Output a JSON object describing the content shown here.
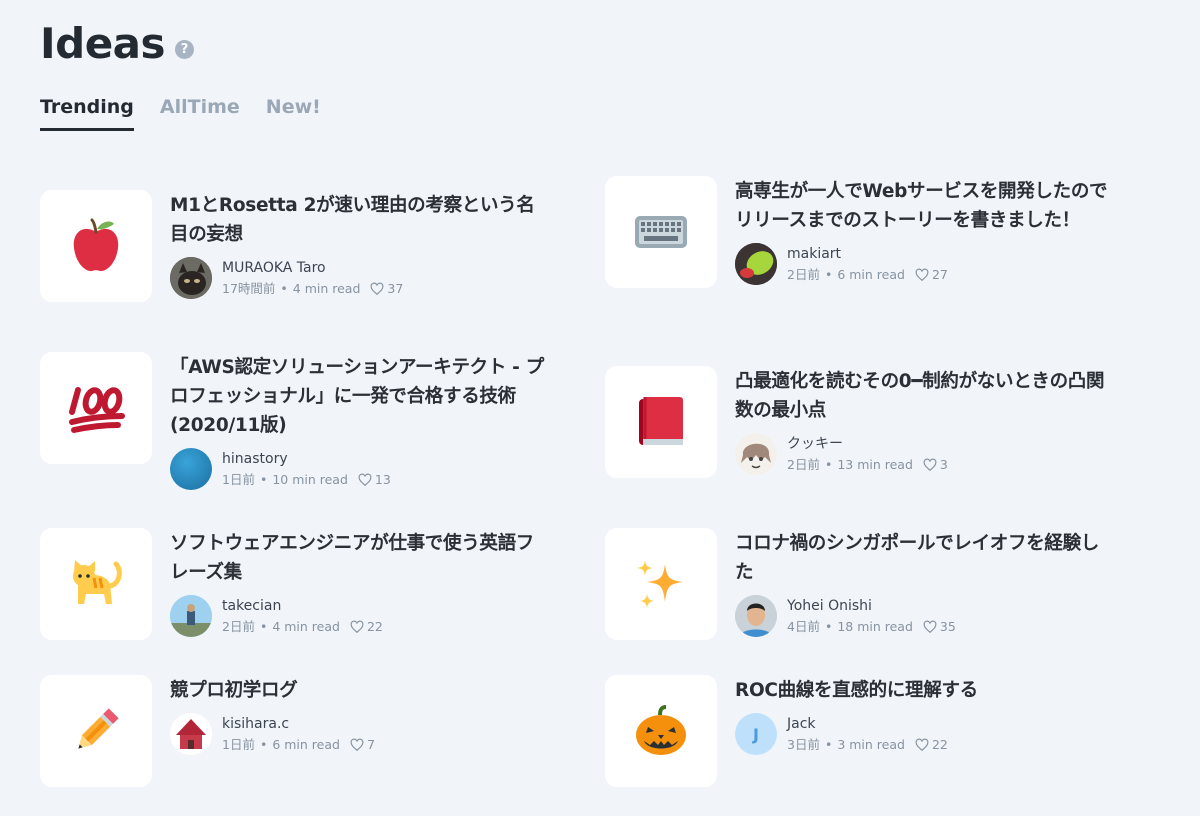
{
  "page": {
    "title": "Ideas",
    "help_icon": "?"
  },
  "tabs": [
    "Trending",
    "AllTime",
    "New!"
  ],
  "articles": [
    {
      "icon": "apple-icon",
      "title": "M1とRosetta 2が速い理由の考察という名目の妄想",
      "author": "MURAOKA Taro",
      "time": "17時間前",
      "read": "4 min read",
      "likes": "37"
    },
    {
      "icon": "keyboard-icon",
      "title": "高専生が一人でWebサービスを開発したのでリリースまでのストーリーを書きました！",
      "author": "makiart",
      "time": "2日前",
      "read": "6 min read",
      "likes": "27"
    },
    {
      "icon": "hundred-points-icon",
      "title": "「AWS認定ソリューションアーキテクト - プロフェッショナル」に一発で合格する技術(2020/11版)",
      "author": "hinastory",
      "time": "1日前",
      "read": "10 min read",
      "likes": "13"
    },
    {
      "icon": "book-icon",
      "title": "凸最適化を読むその0━制約がないときの凸関数の最小点",
      "author": "クッキー",
      "time": "2日前",
      "read": "13 min read",
      "likes": "3"
    },
    {
      "icon": "cat-icon",
      "title": "ソフトウェアエンジニアが仕事で使う英語フレーズ集",
      "author": "takecian",
      "time": "2日前",
      "read": "4 min read",
      "likes": "22"
    },
    {
      "icon": "sparkles-icon",
      "title": "コロナ禍のシンガポールでレイオフを経験した",
      "author": "Yohei Onishi",
      "time": "4日前",
      "read": "18 min read",
      "likes": "35"
    },
    {
      "icon": "pencil-icon",
      "title": "競プロ初学ログ",
      "author": "kisihara.c",
      "time": "1日前",
      "read": "6 min read",
      "likes": "7"
    },
    {
      "icon": "jack-o-lantern-icon",
      "title": "ROC曲線を直感的に理解する",
      "author": "Jack",
      "time": "3日前",
      "read": "3 min read",
      "likes": "22",
      "avatar_letter": "J"
    }
  ],
  "stats_separator": "•"
}
